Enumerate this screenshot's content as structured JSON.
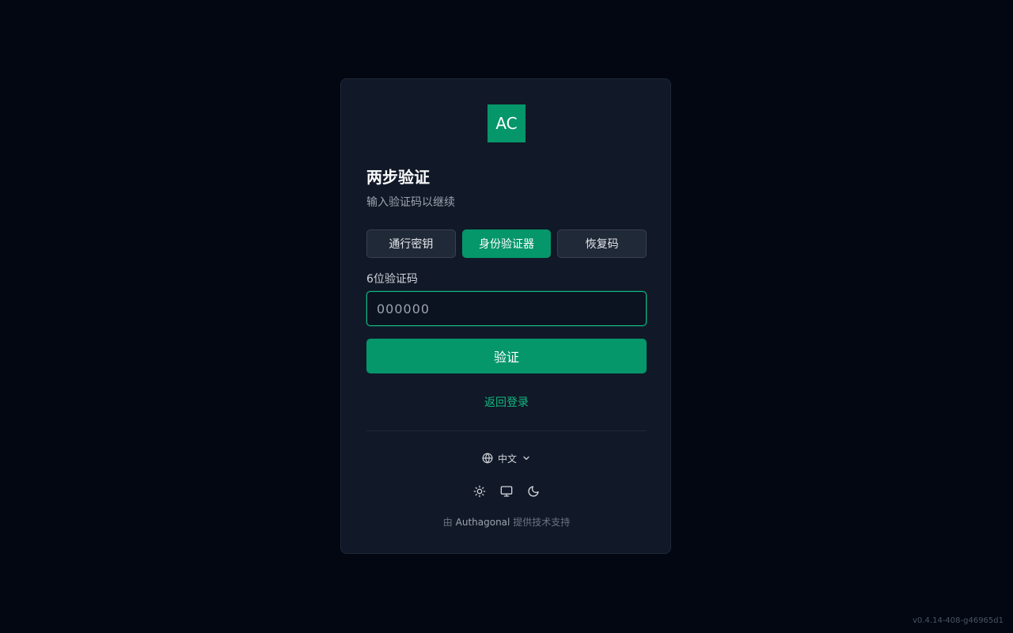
{
  "logo": {
    "text": "AC",
    "color": "#059669"
  },
  "header": {
    "title": "两步验证",
    "subtitle": "输入验证码以继续"
  },
  "tabs": [
    {
      "label": "通行密钥",
      "active": false
    },
    {
      "label": "身份验证器",
      "active": true
    },
    {
      "label": "恢复码",
      "active": false
    }
  ],
  "form": {
    "code_label": "6位验证码",
    "code_value": "",
    "code_placeholder": "000000",
    "verify_label": "验证"
  },
  "back_link": "返回登录",
  "language": {
    "selected": "中文",
    "icon": "globe-icon",
    "chevron": "chevron-down-icon"
  },
  "theme_toggle": {
    "options": [
      "sun-icon",
      "monitor-icon",
      "moon-icon"
    ]
  },
  "footer": {
    "prefix": "由",
    "brand": "Authagonal",
    "suffix": "提供技术支持"
  },
  "version": "v0.4.14-408-g46965d1",
  "colors": {
    "accent": "#059669",
    "background": "#030712",
    "card": "#111827"
  }
}
